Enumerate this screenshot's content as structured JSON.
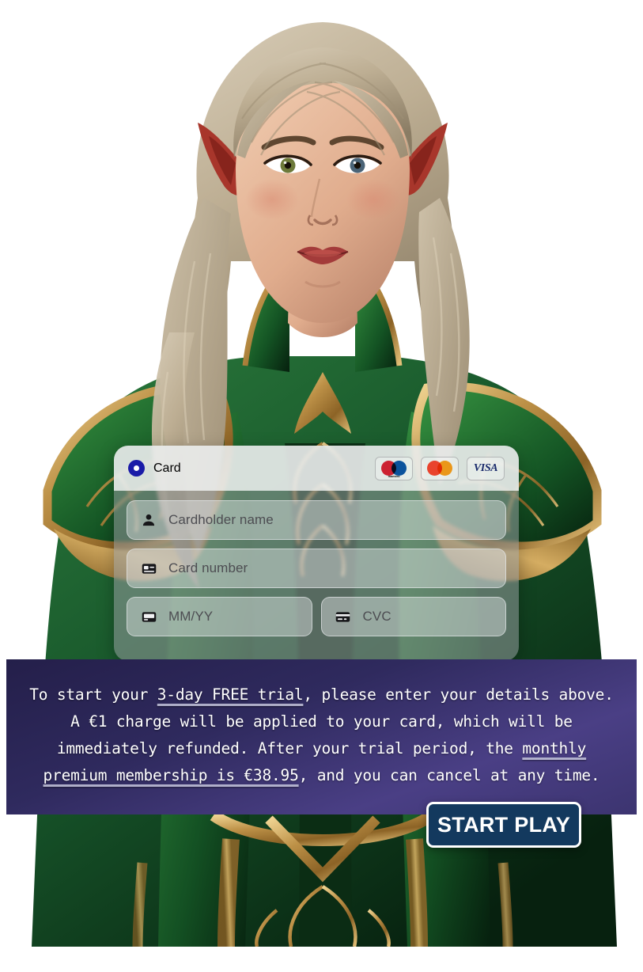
{
  "payment_form": {
    "brand_label": "Card",
    "brand_icon": "radio-dot-icon",
    "payment_brands": [
      {
        "name": "maestro",
        "label": "maestro",
        "colors": [
          "#cc2131",
          "#0a57a4"
        ]
      },
      {
        "name": "mastercard",
        "label": "",
        "colors": [
          "#e9432d",
          "#f79e1b"
        ]
      },
      {
        "name": "visa",
        "label": "VISA",
        "colors": [
          "#1a2a6b"
        ]
      }
    ],
    "fields": [
      {
        "name": "cardholder-name",
        "placeholder": "Cardholder name",
        "value": "",
        "icon": "person-icon"
      },
      {
        "name": "card-number",
        "placeholder": "Card number",
        "value": "",
        "icon": "card-number-icon"
      },
      {
        "name": "expiry-date",
        "placeholder": "MM/YY",
        "value": "",
        "icon": "calendar-card-icon"
      },
      {
        "name": "cvc",
        "placeholder": "CVC",
        "value": "",
        "icon": "cvc-card-icon"
      }
    ]
  },
  "disclaimer": {
    "lead": "To start your ",
    "trial_highlight": "3-day FREE trial",
    "middle": ", please enter your details above. A €1 charge will be applied to your card, which will be immediately refunded. After your trial period, the ",
    "price_highlight": "monthly premium membership is €38.95",
    "tail": ", and you can cancel at any time.",
    "full_text": "To start your 3-day FREE trial, please enter your details above. A €1 charge will be applied to your card, which will be immediately refunded. After your trial period, the monthly premium membership is €38.95, and you can cancel at any time."
  },
  "cta": {
    "start_play_label": "START PLAY",
    "background_color": "#13395e",
    "border_color": "#ffffff",
    "text_color": "#ffffff"
  },
  "artwork": {
    "subject": "elf-woman-character",
    "description": "Fantasy elf woman with pointed ears, long wavy blonde-grey hair, wearing ornate green and gold armor",
    "palette": {
      "armor_green": "#1c5a2c",
      "armor_green_dark": "#0d2e17",
      "gold": "#b8893f",
      "gold_light": "#d9b46a",
      "hair_light": "#c9bba4",
      "hair_dark": "#8d7f68",
      "skin": "#e0b49a",
      "skin_shadow": "#b98a6e",
      "ear_red": "#a02a22",
      "background": "#ffffff"
    }
  },
  "banner_style": {
    "gradient_start": "#241f4a",
    "gradient_end": "#3c3470"
  }
}
